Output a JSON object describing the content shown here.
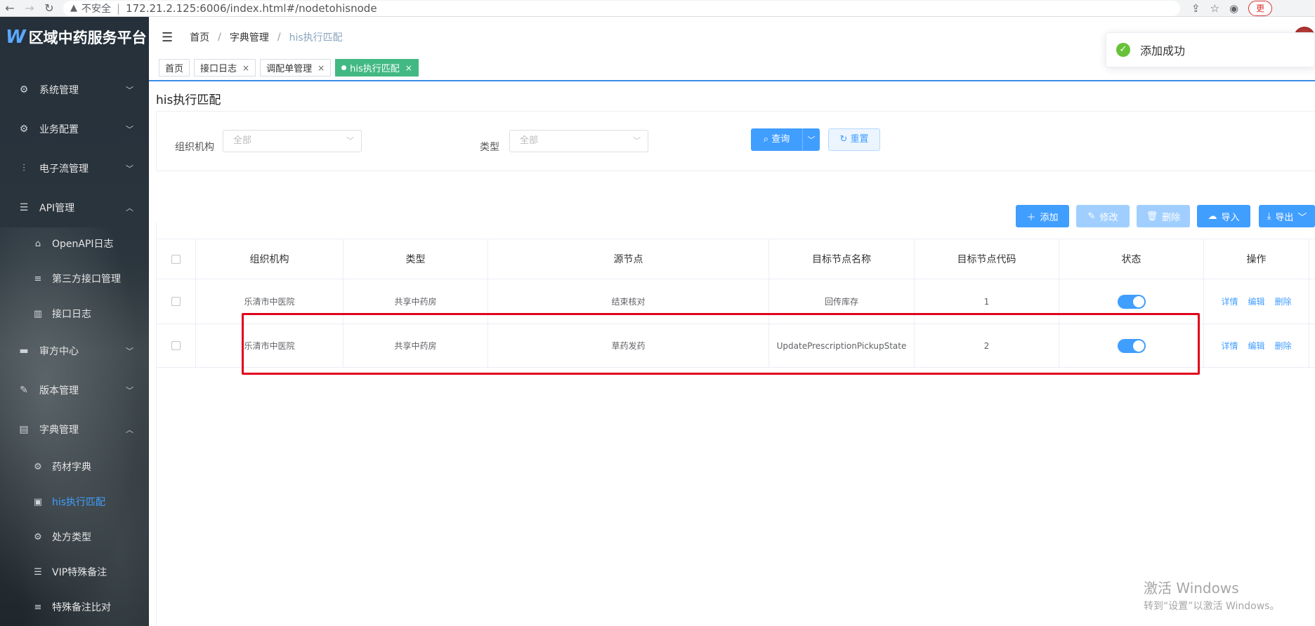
{
  "browser": {
    "security_label": "不安全",
    "url": "172.21.2.125:6006/index.html#/nodetohisnode",
    "badge": "更"
  },
  "sidebar": {
    "app_title": "区域中药服务平台",
    "menus": [
      {
        "label": "系统管理",
        "icon": "gear-icon"
      },
      {
        "label": "业务配置",
        "icon": "gear-icon"
      },
      {
        "label": "电子流管理",
        "icon": "sliders-icon"
      },
      {
        "label": "API管理",
        "icon": "sliders-icon"
      },
      {
        "label": "审方中心",
        "icon": "monitor-icon"
      },
      {
        "label": "版本管理",
        "icon": "edit-icon"
      },
      {
        "label": "字典管理",
        "icon": "document-icon"
      }
    ],
    "api_sub": [
      {
        "label": "OpenAPI日志"
      },
      {
        "label": "第三方接口管理"
      },
      {
        "label": "接口日志"
      }
    ],
    "dict_sub": [
      {
        "label": "药材字典"
      },
      {
        "label": "his执行匹配"
      },
      {
        "label": "处方类型"
      },
      {
        "label": "VIP特殊备注"
      },
      {
        "label": "特殊备注比对"
      }
    ]
  },
  "breadcrumb": {
    "home": "首页",
    "dict": "字典管理",
    "current": "his执行匹配",
    "sep": "/"
  },
  "tabs": [
    {
      "label": "首页"
    },
    {
      "label": "接口日志"
    },
    {
      "label": "调配单管理"
    },
    {
      "label": "his执行匹配"
    }
  ],
  "page": {
    "title": "his执行匹配"
  },
  "filter": {
    "org_label": "组织机构",
    "org_placeholder": "全部",
    "type_label": "类型",
    "type_placeholder": "全部",
    "query_label": "查询",
    "reset_label": "重置"
  },
  "actions": {
    "add": "添加",
    "edit": "修改",
    "delete": "删除",
    "import": "导入",
    "export": "导出"
  },
  "table": {
    "headers": [
      "组织机构",
      "类型",
      "源节点",
      "目标节点名称",
      "目标节点代码",
      "状态",
      "操作"
    ],
    "rows": [
      {
        "org": "乐清市中医院",
        "type": "共享中药房",
        "source": "结束核对",
        "target_name": "回传库存",
        "target_code": "1",
        "status": true
      },
      {
        "org": "乐清市中医院",
        "type": "共享中药房",
        "source": "草药发药",
        "target_name": "UpdatePrescriptionPickupState",
        "target_code": "2",
        "status": true
      }
    ],
    "ops": {
      "detail": "详情",
      "edit": "编辑",
      "delete": "删除"
    }
  },
  "toast": {
    "message": "添加成功"
  },
  "watermark": {
    "line1": "激活 Windows",
    "line2": "转到“设置”以激活 Windows。"
  },
  "colors": {
    "primary": "#409eff",
    "success": "#42b983",
    "sidebar_bg": "#2b353d",
    "highlight": "#e0001b"
  }
}
